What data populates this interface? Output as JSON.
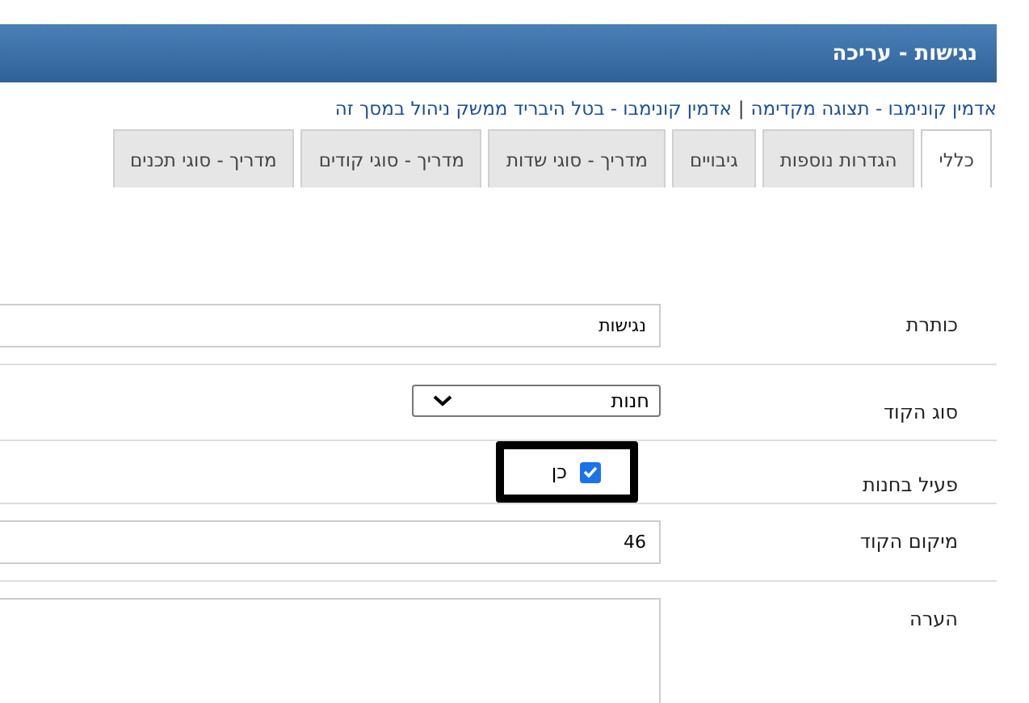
{
  "header": {
    "title": "נגישות - עריכה"
  },
  "breadcrumb": {
    "links": [
      "אדמין קונימבו - תצוגה מקדימה",
      "אדמין קונימבו - בטל היבריד ממשק ניהול במסך זה"
    ],
    "separator": "|"
  },
  "tabs": [
    {
      "label": "כללי",
      "selected": true
    },
    {
      "label": "הגדרות נוספות",
      "selected": false
    },
    {
      "label": "גיבויים",
      "selected": false
    },
    {
      "label": "מדריך - סוגי שדות",
      "selected": false
    },
    {
      "label": "מדריך - סוגי קודים",
      "selected": false
    },
    {
      "label": "מדריך - סוגי תכנים",
      "selected": false
    }
  ],
  "form": [
    {
      "kind": "text",
      "label": "כותרת",
      "value": "נגישות"
    },
    {
      "kind": "select",
      "label": "סוג הקוד",
      "value": "חנות"
    },
    {
      "kind": "checkbox",
      "label": "פעיל בחנות",
      "checked": true,
      "text": "כן",
      "highlighted": true
    },
    {
      "kind": "text",
      "label": "מיקום הקוד",
      "value": "46"
    },
    {
      "kind": "textarea",
      "label": "הערה"
    }
  ]
}
